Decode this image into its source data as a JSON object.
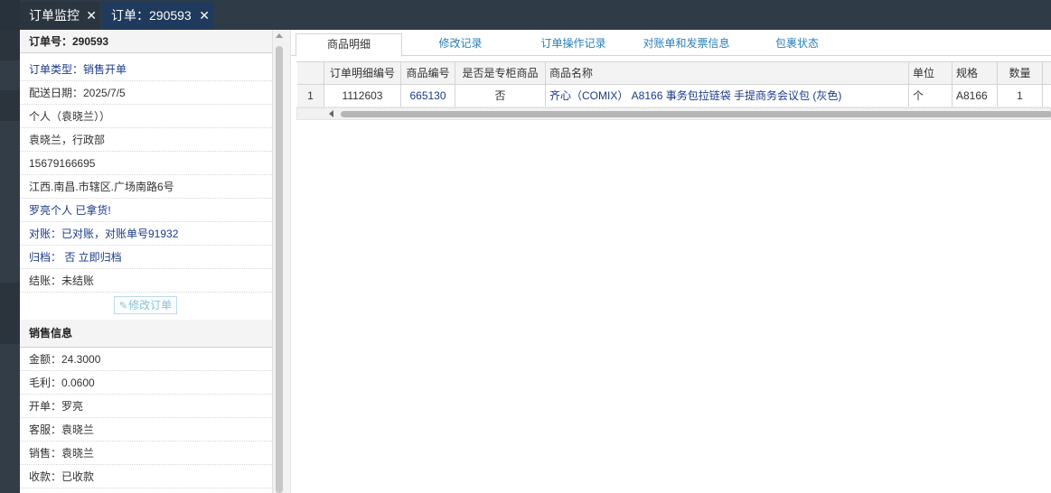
{
  "tabs": [
    {
      "label": "订单监控"
    },
    {
      "label": "订单：290593"
    }
  ],
  "order": {
    "number": "订单号：290593",
    "type": "订单类型：销售开单",
    "delivery_date": "配送日期：2025/7/5",
    "customer": "个人（袁晓兰））",
    "contact": "袁晓兰，行政部",
    "phone": "15679166695",
    "address": "江西.南昌.市辖区.广场南路6号",
    "note": "罗亮个人 已拿货!",
    "reconcile": "对账：已对账，对账单号91932",
    "archive": "归档：  否 立即归档",
    "settlement": "结账：未结账",
    "edit_button": "修改订单"
  },
  "sales": {
    "header": "销售信息",
    "amount": "金额：24.3000",
    "gross_profit": "毛利：0.0600",
    "issuer": "开单：罗亮",
    "service": "客服：袁晓兰",
    "salesperson": "销售：袁晓兰",
    "receipt": "收款：已收款"
  },
  "content_tabs": [
    {
      "label": "商品明细"
    },
    {
      "label": "修改记录"
    },
    {
      "label": "订单操作记录"
    },
    {
      "label": "对账单和发票信息"
    },
    {
      "label": "包裹状态"
    }
  ],
  "table": {
    "columns": [
      "",
      "订单明细编号",
      "商品编号",
      "是否是专柜商品",
      "商品名称",
      "单位",
      "规格",
      "数量"
    ],
    "rows": [
      [
        "1",
        "1112603",
        "665130",
        "否",
        "齐心（COMIX） A8166 事务包拉链袋 手提商务会议包 (灰色)",
        "个",
        "A8166",
        "1"
      ]
    ]
  },
  "icons": {
    "close": "close-icon",
    "edit": "edit-icon"
  }
}
